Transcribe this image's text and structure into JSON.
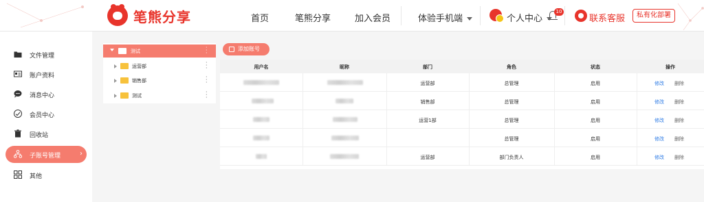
{
  "brand": {
    "name": "笔熊分享",
    "color": "#e8342b"
  },
  "nav": {
    "items": [
      "首页",
      "笔熊分享",
      "加入会员"
    ],
    "mobile": "体验手机端",
    "user_center": "个人中心",
    "notify_count": "10",
    "service": "联系客服",
    "deploy": "私有化部署"
  },
  "sidebar": {
    "items": [
      {
        "label": "文件管理",
        "icon": "folder-icon"
      },
      {
        "label": "账户资料",
        "icon": "id-card-icon"
      },
      {
        "label": "消息中心",
        "icon": "message-icon"
      },
      {
        "label": "会员中心",
        "icon": "member-icon"
      },
      {
        "label": "回收站",
        "icon": "trash-icon"
      },
      {
        "label": "子账号管理",
        "icon": "sub-account-icon",
        "active": true
      },
      {
        "label": "其他",
        "icon": "grid-icon"
      }
    ],
    "accent": "#f57c6e"
  },
  "tree": {
    "root": "测试",
    "children": [
      "运营部",
      "销售部",
      "测试"
    ]
  },
  "toolbar": {
    "add_label": "添加账号"
  },
  "table": {
    "headers": [
      "用户名",
      "昵称",
      "部门",
      "角色",
      "状态",
      "操作"
    ],
    "rows": [
      {
        "dept": "运营部",
        "role": "总管理",
        "status": "启用",
        "edit": "修改",
        "delete": "删除"
      },
      {
        "dept": "销售部",
        "role": "总管理",
        "status": "启用",
        "edit": "修改",
        "delete": "删除"
      },
      {
        "dept": "运营1部",
        "role": "总管理",
        "status": "启用",
        "edit": "修改",
        "delete": "删除"
      },
      {
        "dept": "",
        "role": "总管理",
        "status": "启用",
        "edit": "修改",
        "delete": "删除"
      },
      {
        "dept": "运营部",
        "role": "部门负责人",
        "status": "启用",
        "edit": "修改",
        "delete": "删除"
      }
    ]
  }
}
